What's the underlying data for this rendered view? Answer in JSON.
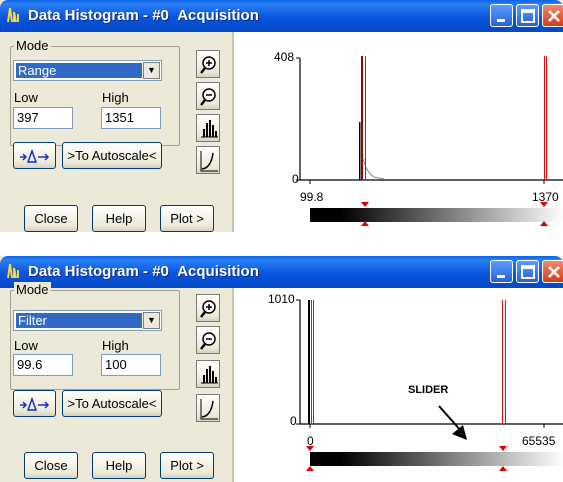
{
  "windows": [
    {
      "title": "Data Histogram - #0",
      "subtitle": "Acquisition",
      "mode_label": "Mode",
      "mode_value": "Range",
      "low_label": "Low",
      "high_label": "High",
      "low_value": "397",
      "high_value": "1351",
      "autoscale_label": ">To Autoscale<",
      "close_label": "Close",
      "help_label": "Help",
      "plot_label": "Plot >",
      "ymax_label": "408",
      "ymin_label": "0",
      "xmin_label": "99.8",
      "xmax_label": "1370",
      "slider_label": ""
    },
    {
      "title": "Data Histogram - #0",
      "subtitle": "Acquisition",
      "mode_label": "Mode",
      "mode_value": "Filter",
      "low_label": "Low",
      "high_label": "High",
      "low_value": "99.6",
      "high_value": "100",
      "autoscale_label": ">To Autoscale<",
      "close_label": "Close",
      "help_label": "Help",
      "plot_label": "Plot >",
      "ymax_label": "1010",
      "ymin_label": "0",
      "xmin_label": "0",
      "xmax_label": "65535",
      "slider_label": "SLIDER"
    }
  ],
  "icons": [
    "histogram-app-icon",
    "minimize-icon",
    "maximize-icon",
    "close-icon",
    "zoom-in-icon",
    "zoom-out-icon",
    "histogram-icon",
    "curve-icon",
    "auto-range-icon",
    "chevron-down-icon"
  ],
  "colors": {
    "titlebar": "#0855dd",
    "selection": "#316ac5",
    "histogram_red": "#e01010",
    "marker_red": "#e00000",
    "face": "#ece9d8"
  }
}
